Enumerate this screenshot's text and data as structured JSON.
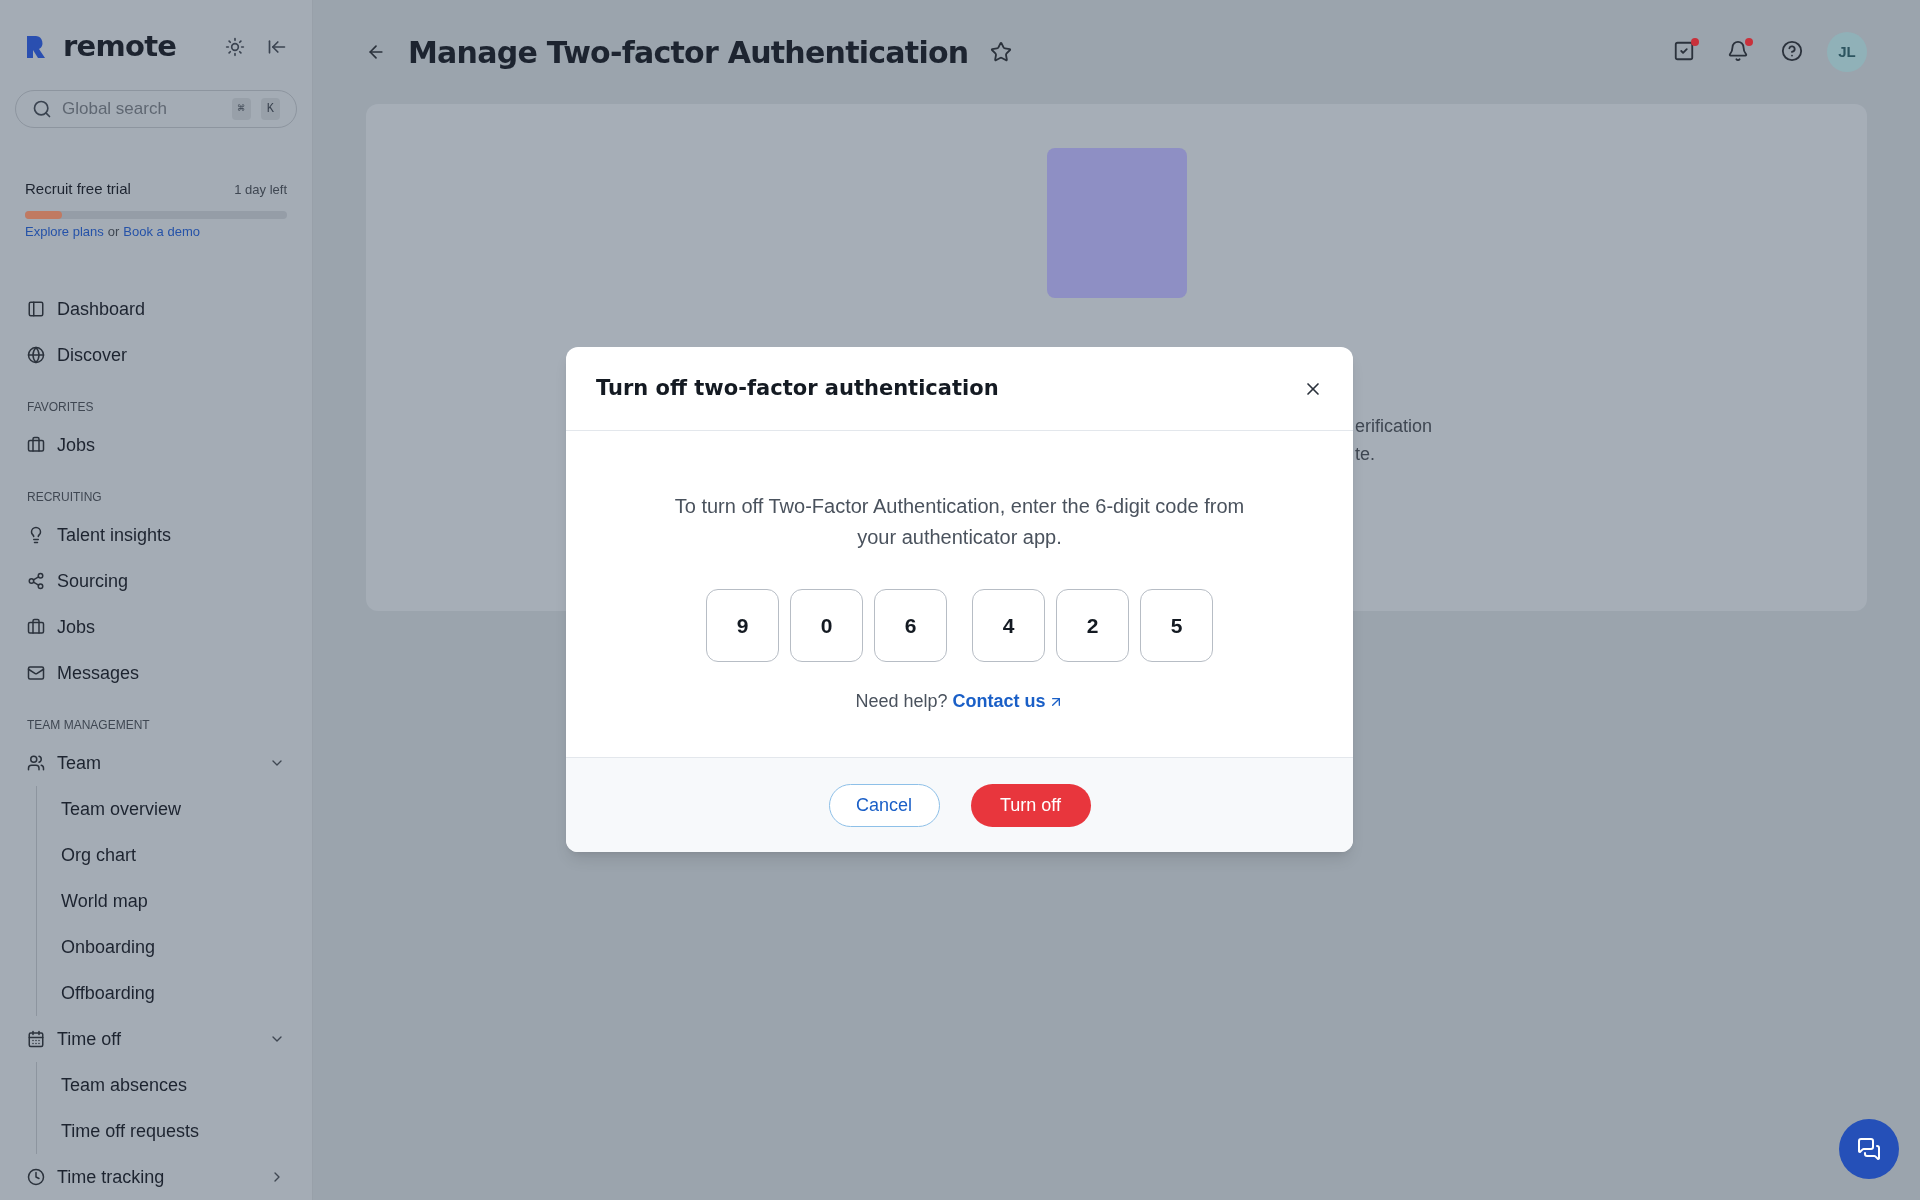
{
  "sidebar": {
    "brand": "remote",
    "search": {
      "placeholder": "Global search",
      "keys": [
        "⌘",
        "K"
      ]
    },
    "trial": {
      "title": "Recruit free trial",
      "remaining": "1 day left",
      "level": 0.14,
      "link_1": "Explore plans",
      "joiner": "or",
      "link_2": "Book a demo"
    },
    "sections": [
      {
        "items": [
          {
            "label": "Dashboard"
          },
          {
            "label": "Discover"
          }
        ]
      },
      {
        "heading": "FAVORITES",
        "items": [
          {
            "label": "Jobs"
          }
        ]
      },
      {
        "heading": "RECRUITING",
        "items": [
          {
            "label": "Talent insights"
          },
          {
            "label": "Sourcing"
          },
          {
            "label": "Jobs"
          },
          {
            "label": "Messages"
          }
        ]
      },
      {
        "heading": "TEAM MANAGEMENT",
        "items": [
          {
            "label": "Team",
            "expanded": true,
            "children": [
              {
                "label": "Team overview"
              },
              {
                "label": "Org chart"
              },
              {
                "label": "World map"
              },
              {
                "label": "Onboarding"
              },
              {
                "label": "Offboarding"
              }
            ]
          },
          {
            "label": "Time off",
            "expanded": true,
            "children": [
              {
                "label": "Team absences"
              },
              {
                "label": "Time off requests"
              }
            ]
          },
          {
            "label": "Time tracking",
            "expanded": false
          }
        ]
      }
    ]
  },
  "header": {
    "title": "Manage Two-factor Authentication",
    "favorite": false,
    "actions": [
      {
        "dot": true
      },
      {
        "dot": true
      },
      {
        "dot": false
      }
    ],
    "avatar": "JL"
  },
  "background_card": {
    "text_lines": [
      "erification",
      "te."
    ]
  },
  "dialog": {
    "title": "Turn off two-factor authentication",
    "message": "To turn off Two-Factor Authentication, enter the 6-digit code from your authenticator app.",
    "digits": [
      "9",
      "0",
      "6",
      "4",
      "2",
      "5"
    ],
    "help": "Need help?",
    "help_link": "Contact us",
    "buttons": [
      {
        "kind": "secondary",
        "label": "Cancel"
      },
      {
        "kind": "danger",
        "label": "Turn off"
      }
    ]
  }
}
